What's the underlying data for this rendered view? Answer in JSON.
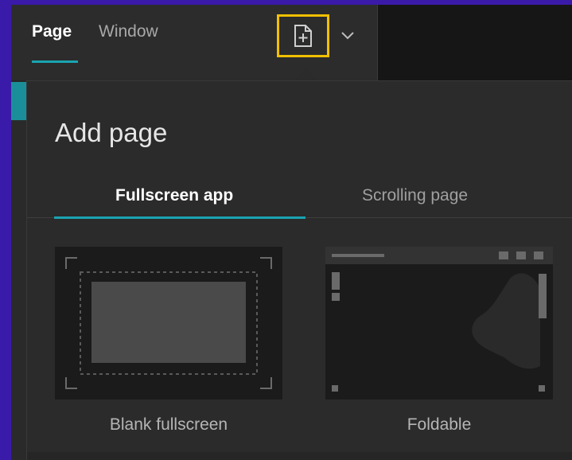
{
  "toolbar": {
    "tabs": [
      {
        "label": "Page",
        "active": true
      },
      {
        "label": "Window",
        "active": false
      }
    ],
    "add_page_icon": "add-page-icon",
    "dropdown_icon": "chevron-down-icon"
  },
  "popover": {
    "title": "Add page",
    "tabs": [
      {
        "label": "Fullscreen app",
        "active": true
      },
      {
        "label": "Scrolling page",
        "active": false
      }
    ],
    "templates": [
      {
        "label": "Blank fullscreen"
      },
      {
        "label": "Foldable"
      }
    ]
  },
  "colors": {
    "accent": "#1aa3b0",
    "highlight": "#f2c000",
    "background": "#3a1aa8"
  }
}
